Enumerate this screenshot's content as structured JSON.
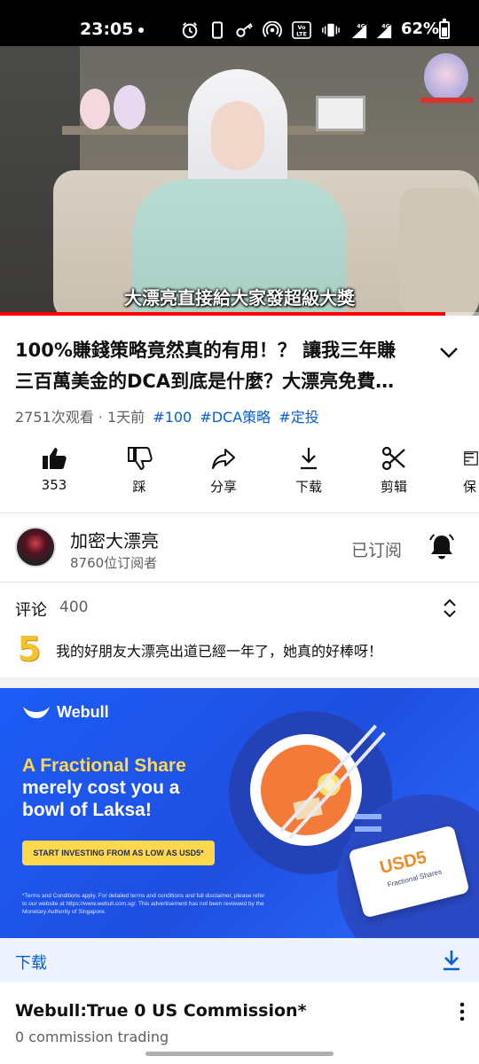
{
  "status_bar": {
    "time": "23:05",
    "battery": "62%",
    "battery_level": 0.62,
    "icons": [
      "alarm-icon",
      "phone-icon",
      "key-icon",
      "hotspot-icon",
      "volte-icon",
      "vibrate-icon",
      "signal-4g-icon",
      "signal-4g-icon",
      "battery-icon"
    ]
  },
  "video": {
    "caption": "大漂亮直接給大家發超級大獎",
    "progress": 0.93,
    "progress_color": "#ff0000"
  },
  "title": "100%賺錢策略竟然真的有用！？ 讓我三年賺三百萬美金的DCA到底是什麼？大漂亮免費…",
  "meta": {
    "views": "2751次观看",
    "separator": " · ",
    "time_ago": "1天前",
    "tags": [
      "#100",
      "#DCA策略",
      "#定投"
    ],
    "tag_color": "#065fd4"
  },
  "actions": {
    "like": "353",
    "dislike": "踩",
    "share": "分享",
    "download": "下载",
    "clip": "剪辑",
    "save": "保"
  },
  "channel": {
    "name": "加密大漂亮",
    "subscribers": "8760位订阅者",
    "subscribed_label": "已订阅"
  },
  "comments": {
    "label": "评论",
    "count": "400",
    "top_comment_avatar": "5",
    "top_comment": "我的好朋友大漂亮出道已經一年了，她真的好棒呀！"
  },
  "ad": {
    "brand": "Webull",
    "headline_line1": "A Fractional Share",
    "headline_line2": "merely cost you a",
    "headline_line3": "bowl of Laksa!",
    "cta": "START INVESTING FROM AS LOW AS USD5*",
    "fine_print": "*Terms and Conditions apply. For detailed terms and conditions and full disclaimer, please refer to our website at https://www.webull.com.sg/. This advertisement has not been reviewed by the Monetary Authority of Singapore.",
    "card_label": "USD5",
    "card_sub": "Fractional Shares",
    "brand_color": "#1d5cf6",
    "accent_color": "#ffd84d",
    "download_label": "下载",
    "title": "Webull:True 0 US Commission*",
    "subtitle": "0 commission trading"
  }
}
